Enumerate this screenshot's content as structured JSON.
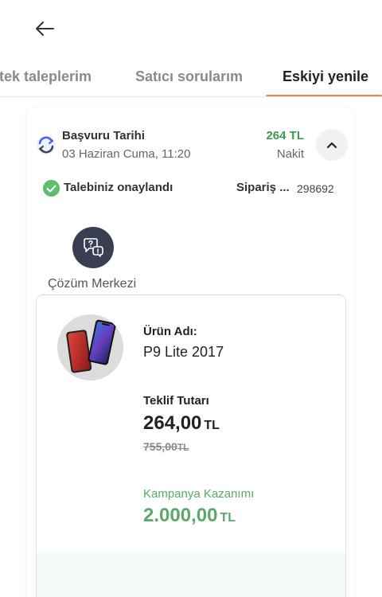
{
  "header": {
    "back_icon": "arrow-left-icon"
  },
  "tabs": [
    {
      "label": "tek taleplerim",
      "active": false
    },
    {
      "label": "Satıcı sorularım",
      "active": false
    },
    {
      "label": "Eskiyi yenile",
      "active": true
    }
  ],
  "colors": {
    "accent": "#f0883e",
    "success": "#3e9a4c",
    "campaign": "#5aa86a",
    "help_button": "#3a3e52"
  },
  "order": {
    "apply_label": "Başvuru Tarihi",
    "apply_date": "03 Haziran Cuma, 11:20",
    "price": "264 TL",
    "payment_method": "Nakit",
    "status_text": "Talebiniz onaylandı",
    "order_label": "Sipariş ...",
    "order_number": "298692",
    "help_label": "Çözüm Merkezi"
  },
  "product": {
    "name_label": "Ürün Adı:",
    "name": "P9 Lite 2017",
    "offer_label": "Teklif Tutarı",
    "offer_amount": "264,00",
    "offer_currency": "TL",
    "old_amount": "755,00",
    "old_currency": "TL",
    "campaign_label": "Kampanya Kazanımı",
    "campaign_amount": "2.000,00",
    "campaign_currency": "TL"
  }
}
